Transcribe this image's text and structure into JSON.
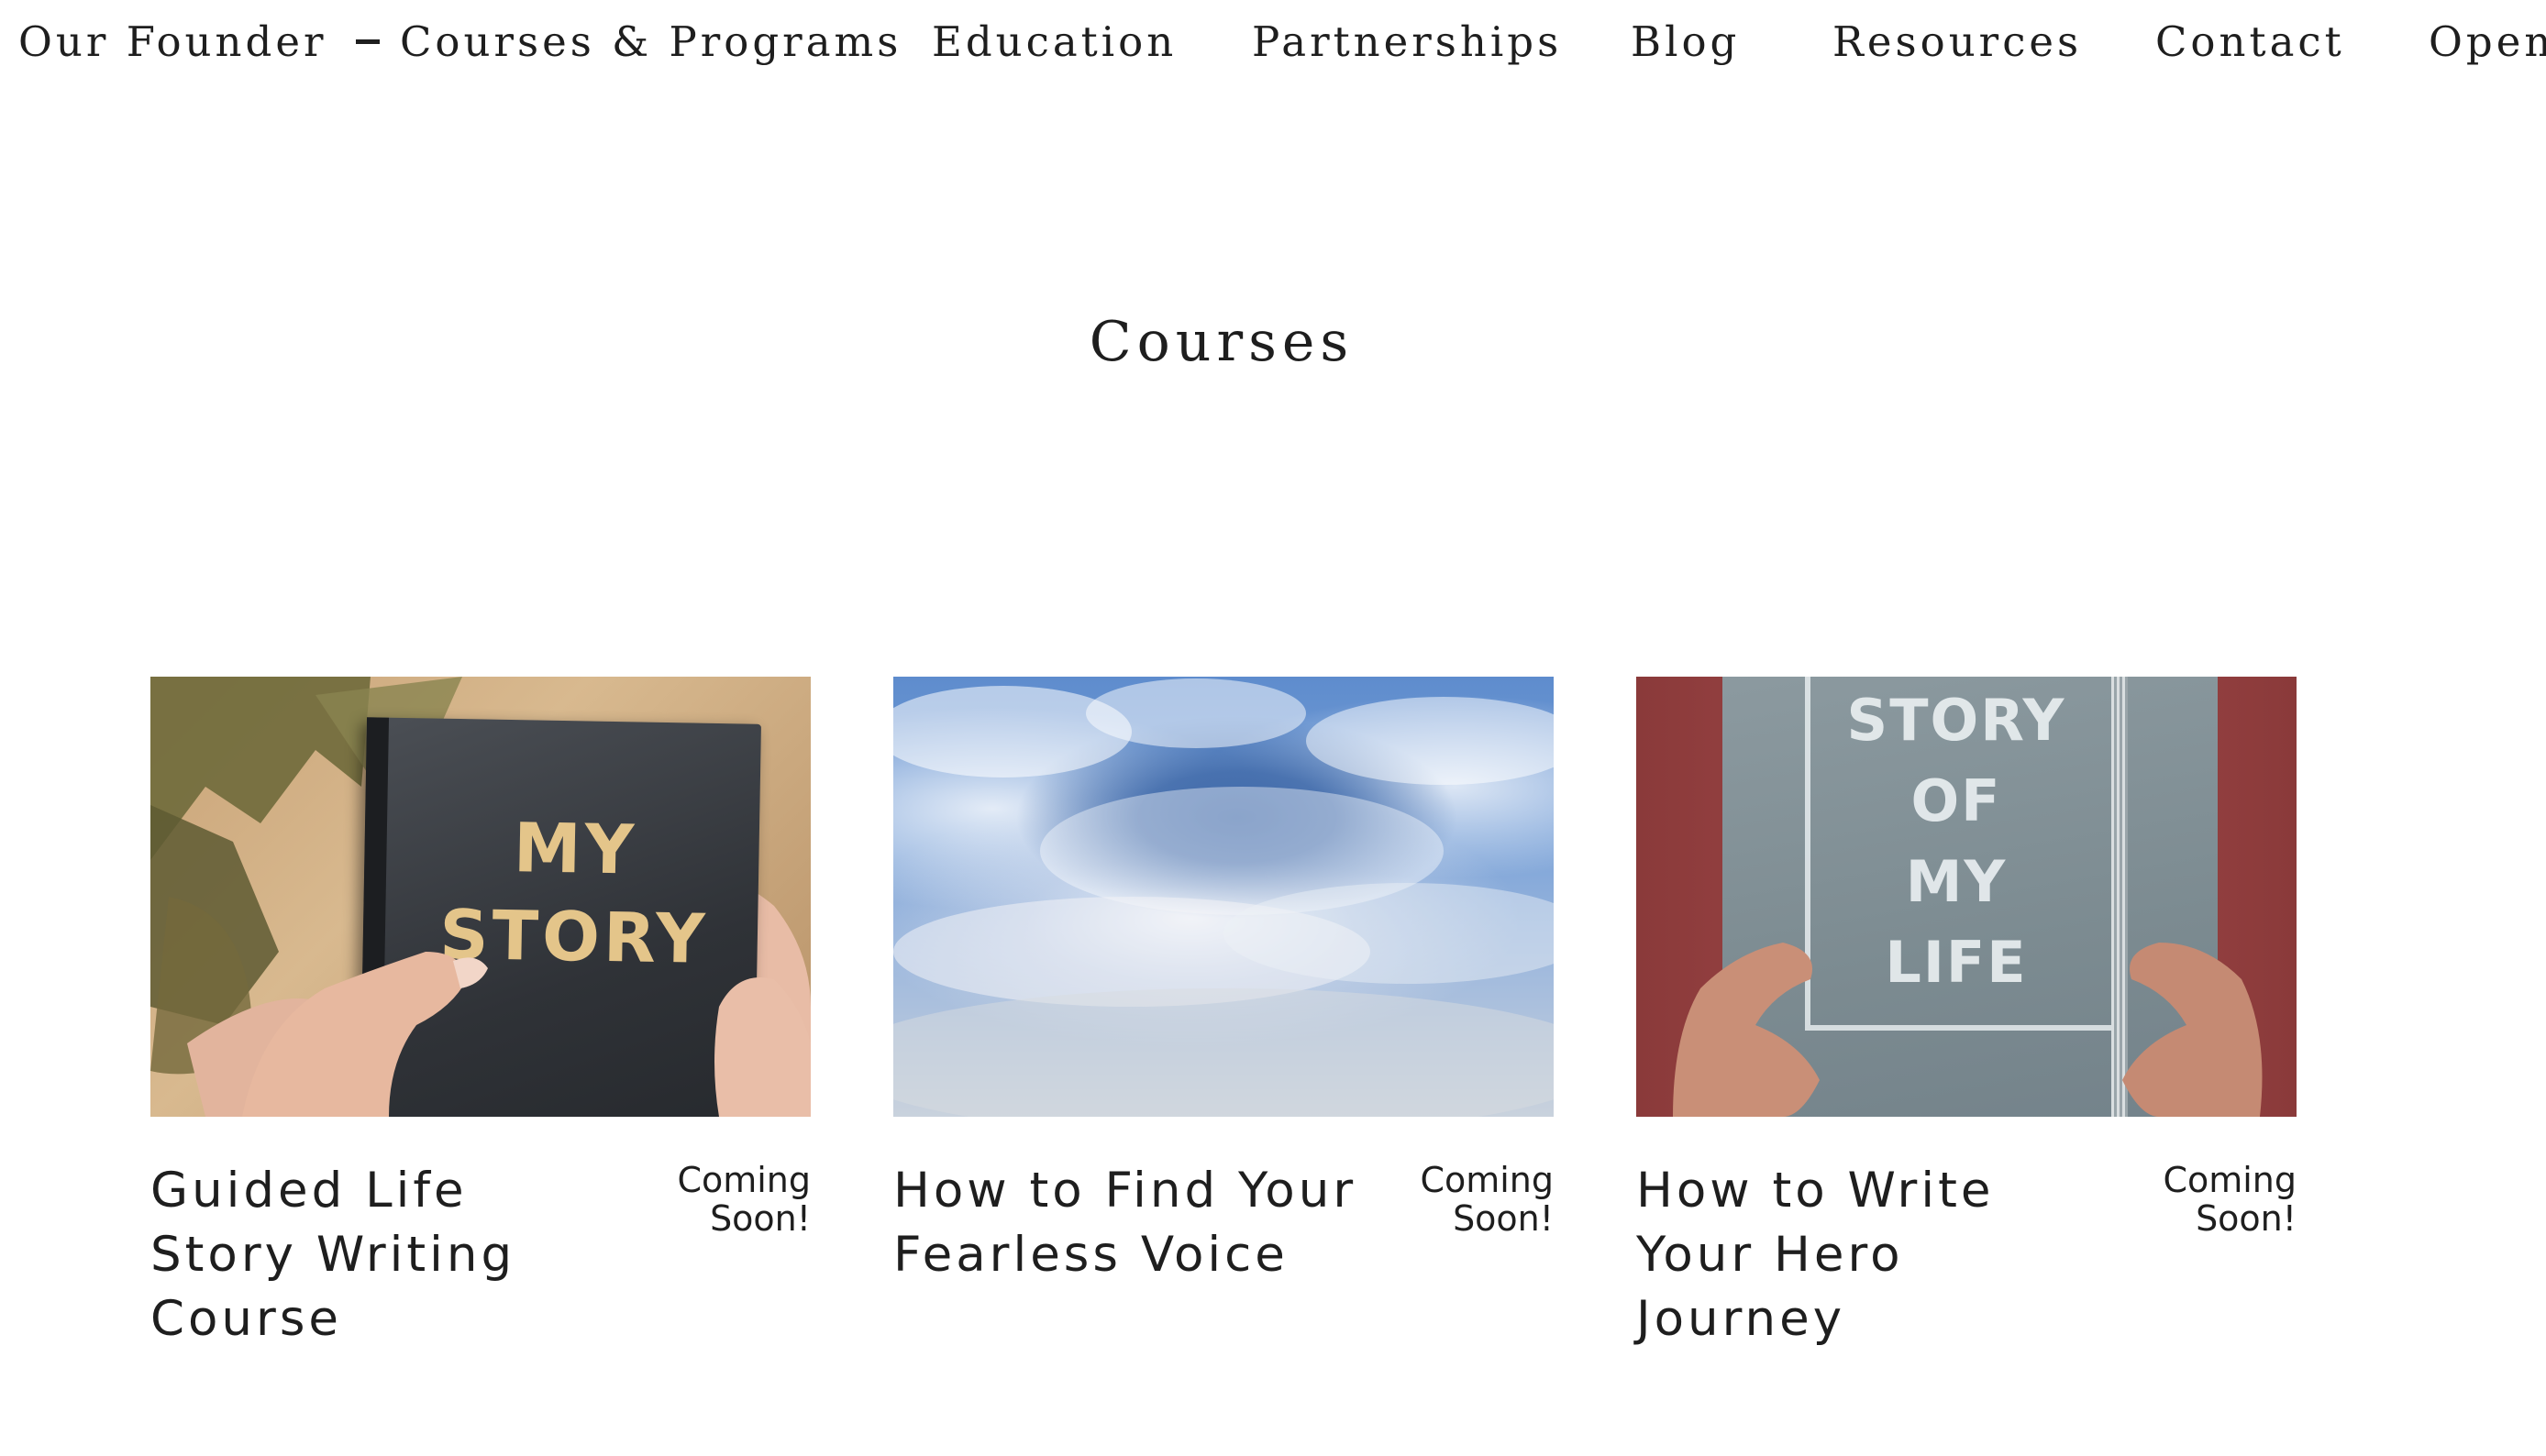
{
  "nav": {
    "items": [
      {
        "label": "Our Founder"
      },
      {
        "label": "Courses & Programs",
        "active": true
      },
      {
        "label": "Education"
      },
      {
        "label": "Partnerships"
      },
      {
        "label": "Blog"
      },
      {
        "label": "Resources"
      },
      {
        "label": "Contact"
      },
      {
        "label": "Openi"
      }
    ]
  },
  "main": {
    "title": "Courses",
    "courses": [
      {
        "image_text": [
          "MY",
          "STORY"
        ],
        "title": "Guided Life Story Writing Course",
        "status": "Coming Soon!"
      },
      {
        "title": "How to Find Your Fearless Voice",
        "status": "Coming Soon!"
      },
      {
        "image_text": [
          "STORY",
          "OF",
          "MY",
          "LIFE"
        ],
        "title": "How to Write Your Hero Journey",
        "status": "Coming Soon!"
      }
    ]
  },
  "colors": {
    "text": "#1e1e1e",
    "background": "#ffffff"
  }
}
